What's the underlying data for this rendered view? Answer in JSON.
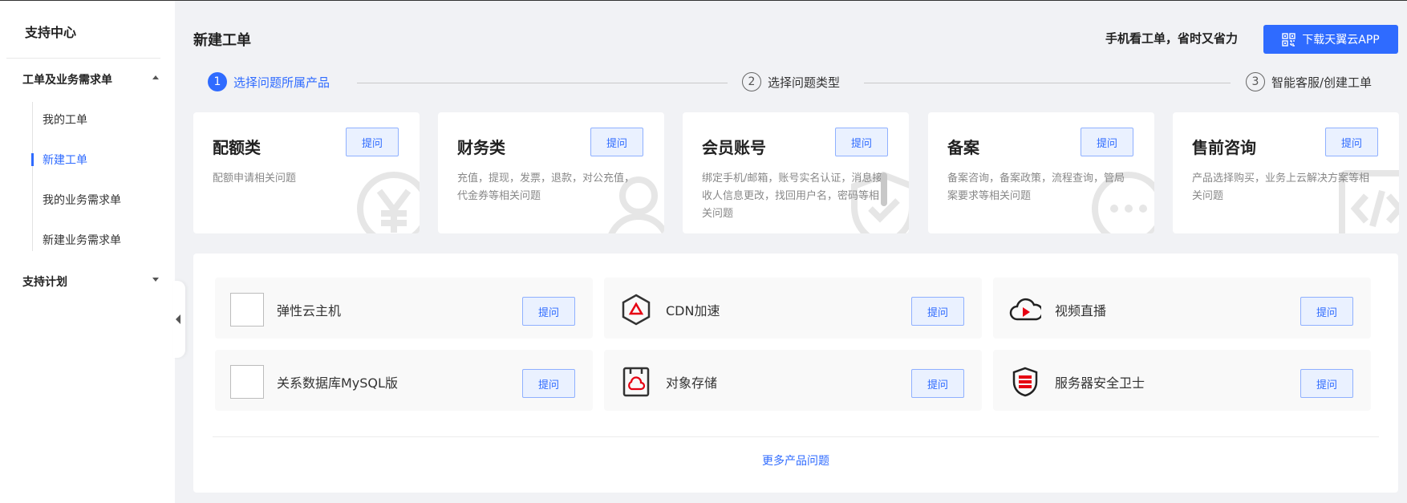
{
  "sidebar": {
    "title": "支持中心",
    "group1": "工单及业务需求单",
    "items": [
      {
        "label": "我的工单",
        "active": false
      },
      {
        "label": "新建工单",
        "active": true
      },
      {
        "label": "我的业务需求单",
        "active": false
      },
      {
        "label": "新建业务需求单",
        "active": false
      }
    ],
    "group2": "支持计划"
  },
  "header": {
    "title": "新建工单",
    "promo": "手机看工单，省时又省力",
    "download_label": "下载天翼云APP"
  },
  "steps": [
    {
      "num": "1",
      "label": "选择问题所属产品",
      "active": true
    },
    {
      "num": "2",
      "label": "选择问题类型",
      "active": false
    },
    {
      "num": "3",
      "label": "智能客服/创建工单",
      "active": false
    }
  ],
  "categories": [
    {
      "title": "配额类",
      "desc": "配额申请相关问题",
      "button": "提问",
      "icon": "yen-icon"
    },
    {
      "title": "财务类",
      "desc": "充值，提现，发票，退款，对公充值，代金券等相关问题",
      "button": "提问",
      "icon": "user-icon"
    },
    {
      "title": "会员账号",
      "desc": "绑定手机/邮箱，账号实名认证，消息接收人信息更改，找回用户名，密码等相关问题",
      "button": "提问",
      "icon": "shield-check-icon"
    },
    {
      "title": "备案",
      "desc": "备案咨询，备案政策，流程查询，管局案要求等相关问题",
      "button": "提问",
      "icon": "chat-bubble-icon"
    },
    {
      "title": "售前咨询",
      "desc": "产品选择购买，业务上云解决方案等相关问题",
      "button": "提问",
      "icon": "code-icon"
    }
  ],
  "products": [
    {
      "name": "弹性云主机",
      "button": "提问",
      "icon": "broken-image-icon"
    },
    {
      "name": "CDN加速",
      "button": "提问",
      "icon": "cdn-hexagon-icon"
    },
    {
      "name": "视频直播",
      "button": "提问",
      "icon": "cloud-play-icon"
    },
    {
      "name": "关系数据库MySQL版",
      "button": "提问",
      "icon": "broken-image-icon"
    },
    {
      "name": "对象存储",
      "button": "提问",
      "icon": "object-storage-icon"
    },
    {
      "name": "服务器安全卫士",
      "button": "提问",
      "icon": "shield-server-icon"
    }
  ],
  "more_link": "更多产品问题",
  "colors": {
    "accent": "#2f6bff",
    "brand_red": "#e60012",
    "watermark": "#e6e6e6"
  }
}
